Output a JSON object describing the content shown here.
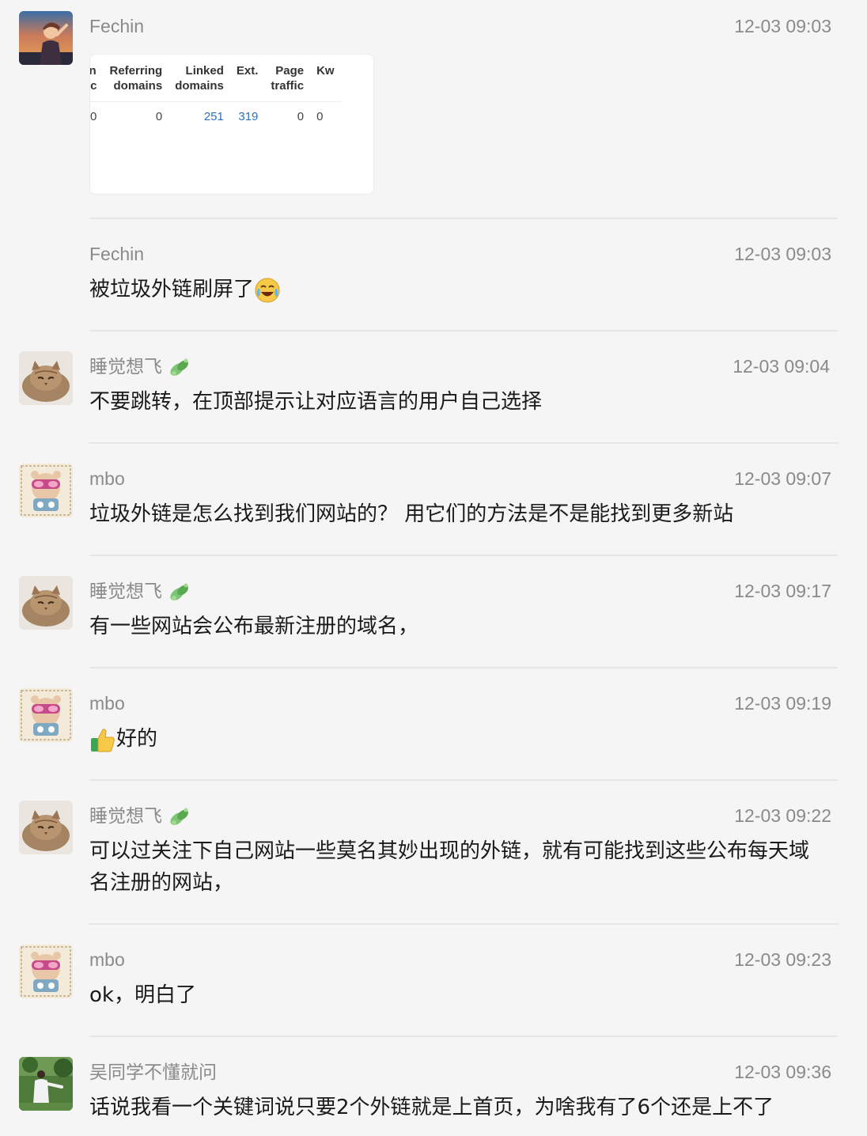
{
  "messages": [
    {
      "name": "Fechin",
      "time": "12-03 09:03",
      "avatar": "sunset-portrait-avatar",
      "screenshot_table": {
        "headers": [
          "ain\nffic",
          "Referring\ndomains",
          "Linked\ndomains",
          "Ext.",
          "Page\ntraffic",
          "Kw"
        ],
        "values": [
          "0",
          "0",
          "251",
          "319",
          "0",
          "0"
        ]
      }
    },
    {
      "name": "Fechin",
      "time": "12-03 09:03",
      "text": "被垃圾外链刷屏了",
      "emoji": "crying-laughing-emoji"
    },
    {
      "name": "睡觉想飞",
      "time": "12-03 09:04",
      "avatar": "cat-avatar",
      "badge": "leaf-icon",
      "text": "不要跳转，在顶部提示让对应语言的用户自己选择"
    },
    {
      "name": "mbo",
      "time": "12-03 09:07",
      "avatar": "bear-goggles-avatar",
      "text": "垃圾外链是怎么找到我们网站的？ 用它们的方法是不是能找到更多新站"
    },
    {
      "name": "睡觉想飞",
      "time": "12-03 09:17",
      "avatar": "cat-avatar",
      "badge": "leaf-icon",
      "text": "有一些网站会公布最新注册的域名，"
    },
    {
      "name": "mbo",
      "time": "12-03 09:19",
      "avatar": "bear-goggles-avatar",
      "emoji": "thumbs-up-emoji",
      "text": "好的"
    },
    {
      "name": "睡觉想飞",
      "time": "12-03 09:22",
      "avatar": "cat-avatar",
      "badge": "leaf-icon",
      "text": "可以过关注下自己网站一些莫名其妙出现的外链，就有可能找到这些公布每天域名注册的网站，"
    },
    {
      "name": "mbo",
      "time": "12-03 09:23",
      "avatar": "bear-goggles-avatar",
      "text": "ok，明白了"
    },
    {
      "name": "吴同学不懂就问",
      "time": "12-03 09:36",
      "avatar": "outdoor-person-avatar",
      "text": "话说我看一个关键词说只要2个外链就是上首页，为啥我有了6个还是上不了"
    }
  ],
  "colors": {
    "background": "#f5f5f5",
    "meta_text": "#8a8a8a",
    "body_text": "#1a1a1a",
    "divider": "#e6e6e6",
    "link_blue": "#2f6fb8"
  }
}
